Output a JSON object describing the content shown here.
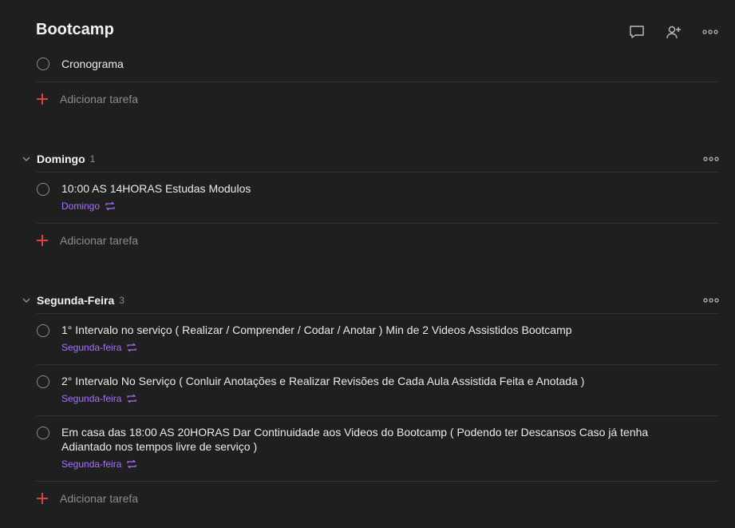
{
  "project": {
    "title": "Bootcamp",
    "icons": {
      "comment": "comment-icon",
      "share": "add-person-icon",
      "more": "more-horizontal-icon"
    }
  },
  "top_tasks": [
    {
      "text": "Cronograma"
    }
  ],
  "add_task_label": "Adicionar tarefa",
  "sections": [
    {
      "title": "Domingo",
      "count": "1",
      "tasks": [
        {
          "text": "10:00 AS 14HORAS Estudas Modulos",
          "due": "Domingo",
          "recurring": true
        }
      ]
    },
    {
      "title": "Segunda-Feira",
      "count": "3",
      "tasks": [
        {
          "text": "1° Intervalo no serviço ( Realizar / Comprender / Codar / Anotar ) Min de 2 Videos Assistidos Bootcamp",
          "due": "Segunda-feira",
          "recurring": true
        },
        {
          "text": "2° Intervalo No Serviço ( Conluir Anotações e Realizar Revisões de Cada Aula Assistida Feita e Anotada )",
          "due": "Segunda-feira",
          "recurring": true
        },
        {
          "text": "Em casa das 18:00 AS 20HORAS Dar Continuidade aos Videos do Bootcamp ( Podendo ter Descansos Caso já tenha Adiantado nos tempos livre de serviço )",
          "due": "Segunda-feira",
          "recurring": true
        }
      ]
    }
  ],
  "colors": {
    "background": "#1f1f1f",
    "accent_purple": "#a970ff",
    "add_red": "#d9443d",
    "divider": "#333333"
  }
}
